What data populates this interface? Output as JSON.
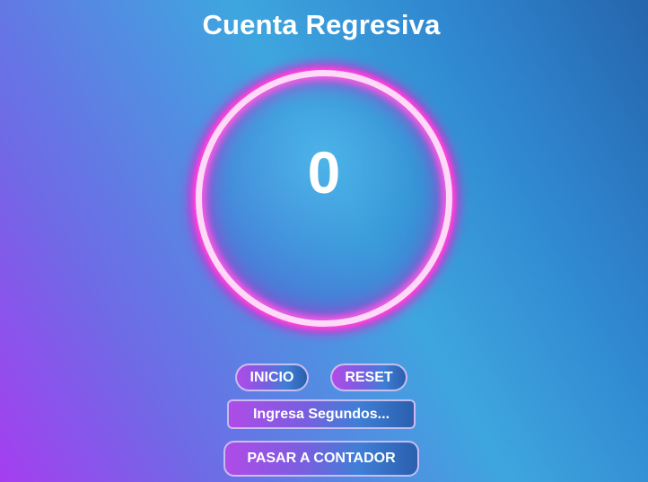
{
  "header": {
    "title": "Cuenta Regresiva"
  },
  "timer": {
    "value": "0"
  },
  "controls": {
    "start_label": "INICIO",
    "reset_label": "RESET",
    "seconds_placeholder": "Ingresa Segundos...",
    "switch_label": "PASAR A CONTADOR"
  },
  "colors": {
    "ring": "#e81fcf",
    "background_start": "#a53ef0",
    "background_end": "#2565ad"
  }
}
